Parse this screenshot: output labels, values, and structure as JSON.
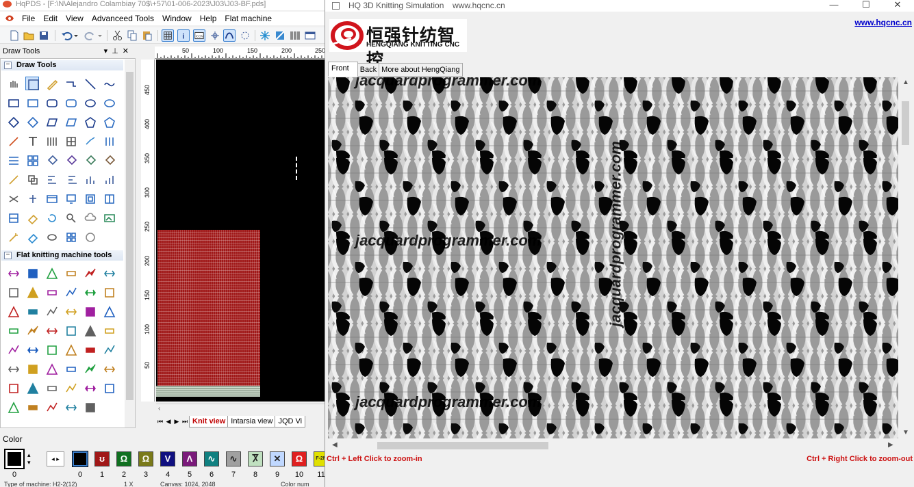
{
  "hqpds": {
    "title": "HqPDS - [F:\\N\\Alejandro Colambiay 70$\\+57\\01-006-2023\\J03\\J03-BF.pds]",
    "menu": [
      "File",
      "Edit",
      "View",
      "Advanceed Tools",
      "Window",
      "Help",
      "Flat machine"
    ],
    "draw_tools_header": "Draw Tools",
    "section_draw_tools": "Draw Tools",
    "section_flat_tools": "Flat knitting machine tools",
    "ruler_top": [
      "50",
      "100",
      "150",
      "200",
      "250"
    ],
    "ruler_left": [
      "450",
      "400",
      "350",
      "300",
      "250",
      "200",
      "150",
      "100",
      "50"
    ],
    "view_tabs": [
      "Knit view",
      "Intarsia view",
      "JQD Vi"
    ],
    "color_label": "Color",
    "main_color_number": "0",
    "color_chips": [
      {
        "num": "0",
        "color": "#000000",
        "glyph": ""
      },
      {
        "num": "1",
        "color": "#a01818",
        "glyph": "ʊ"
      },
      {
        "num": "2",
        "color": "#107020",
        "glyph": "Ω"
      },
      {
        "num": "3",
        "color": "#7a7a1a",
        "glyph": "Ω"
      },
      {
        "num": "4",
        "color": "#101080",
        "glyph": "V"
      },
      {
        "num": "5",
        "color": "#7a1a7a",
        "glyph": "Λ"
      },
      {
        "num": "6",
        "color": "#108080",
        "glyph": "∿"
      },
      {
        "num": "7",
        "color": "#a0a0a0",
        "glyph": "∿"
      },
      {
        "num": "8",
        "color": "#c0e0c0",
        "glyph": "Ⴟ"
      },
      {
        "num": "9",
        "color": "#c0d8ff",
        "glyph": "✕"
      },
      {
        "num": "10",
        "color": "#e02020",
        "glyph": "Ω"
      },
      {
        "num": "11",
        "color": "#e0e000",
        "glyph": "F-2N"
      }
    ],
    "status": [
      "Type of machine: H2-2(12)",
      "1 X",
      "Canvas: 1024, 2048",
      "Color num"
    ]
  },
  "sim": {
    "title": "HQ 3D Knitting Simulation",
    "title_url": "www.hqcnc.cn",
    "logo_cn": "恒强针纺智控",
    "logo_en": "HENGQIANG KNITTING CNC",
    "link": "www.hqcnc.cn",
    "tabs": [
      "Front",
      "Back",
      "More about HengQiang"
    ],
    "watermark": "jacquardprogrammer.com",
    "zoom_in_hint": "Ctrl + Left Click to zoom-in",
    "zoom_out_hint": "Ctrl + Right Click to zoom-out",
    "win_minimize": "—",
    "win_maximize": "☐",
    "win_close": "✕"
  }
}
